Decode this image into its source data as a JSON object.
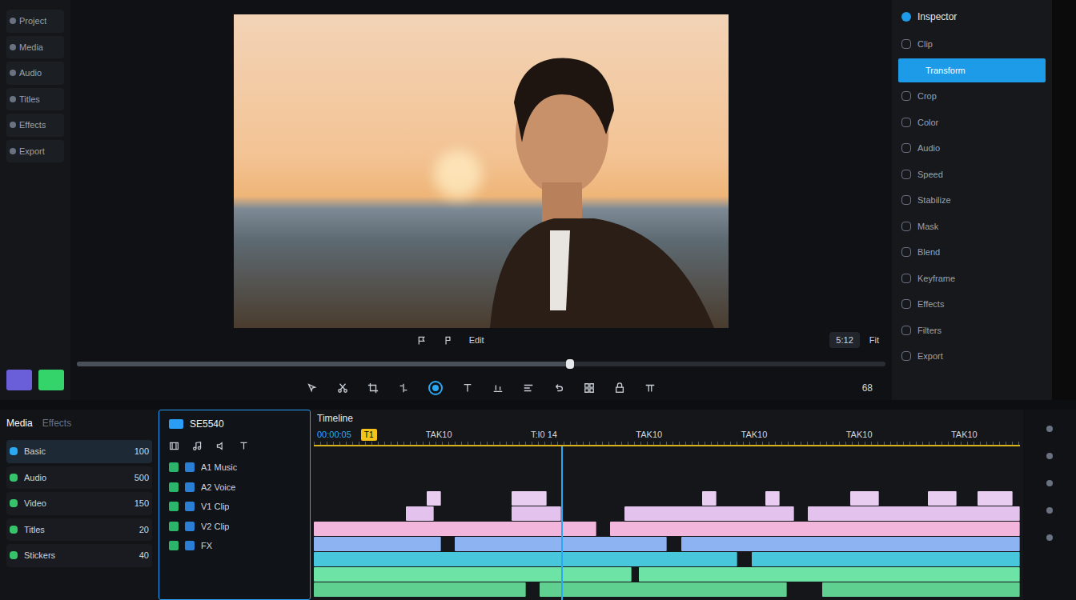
{
  "left_panel": {
    "items": [
      {
        "label": "Project"
      },
      {
        "label": "Media"
      },
      {
        "label": "Audio"
      },
      {
        "label": "Titles"
      },
      {
        "label": "Effects"
      },
      {
        "label": "Export"
      }
    ],
    "swatches": [
      {
        "color": "#6a5fd8"
      },
      {
        "color": "#35d46a"
      }
    ]
  },
  "preview": {
    "controls": [
      "Edit"
    ],
    "timecode": "5:12",
    "zoom": "Fit",
    "scrubber": {
      "level": 0.61
    },
    "zoom_value": "68"
  },
  "inspector": {
    "title": "Inspector",
    "items": [
      {
        "label": "Clip",
        "selected": false
      },
      {
        "label": "Transform",
        "selected": true
      },
      {
        "label": "Crop",
        "selected": false
      },
      {
        "label": "Color",
        "selected": false
      },
      {
        "label": "Audio",
        "selected": false
      },
      {
        "label": "Speed",
        "selected": false
      },
      {
        "label": "Stabilize",
        "selected": false
      },
      {
        "label": "Mask",
        "selected": false
      },
      {
        "label": "Blend",
        "selected": false
      },
      {
        "label": "Keyframe",
        "selected": false
      },
      {
        "label": "Effects",
        "selected": false
      },
      {
        "label": "Filters",
        "selected": false
      },
      {
        "label": "Export",
        "selected": false
      }
    ]
  },
  "media_panel": {
    "tabs": [
      {
        "label": "Media",
        "selected": true
      },
      {
        "label": "Effects",
        "selected": false
      }
    ],
    "rows": [
      {
        "label": "Basic",
        "count": "100",
        "selected": true
      },
      {
        "label": "Audio",
        "count": "500",
        "selected": false
      },
      {
        "label": "Video",
        "count": "150",
        "selected": false
      },
      {
        "label": "Titles",
        "count": "20",
        "selected": false
      },
      {
        "label": "Stickers",
        "count": "40",
        "selected": false
      }
    ]
  },
  "clip_panel": {
    "title": "SE5540",
    "rows": [
      {
        "label": "A1 Music"
      },
      {
        "label": "A2 Voice"
      },
      {
        "label": "V1 Clip"
      },
      {
        "label": "V2 Clip"
      },
      {
        "label": "FX"
      }
    ]
  },
  "timeline": {
    "title": "Timeline",
    "timecode": "00:00:05",
    "badge": "T1",
    "ticks": [
      "TAK10",
      "T:I0 14",
      "TAK10",
      "TAK10",
      "TAK10",
      "TAK10"
    ],
    "playhead": {
      "level": 0.35
    },
    "tracks": [
      {
        "color": "#e9cdf1",
        "clips": [
          [
            16,
            2
          ],
          [
            28,
            5
          ],
          [
            55,
            2
          ],
          [
            64,
            2
          ],
          [
            76,
            4
          ],
          [
            87,
            4
          ],
          [
            94,
            5
          ]
        ]
      },
      {
        "color": "#e3c3ee",
        "clips": [
          [
            13,
            4
          ],
          [
            28,
            7
          ],
          [
            44,
            24
          ],
          [
            70,
            30
          ]
        ]
      },
      {
        "color": "#f2b5dc",
        "clips": [
          [
            0,
            40
          ],
          [
            42,
            58
          ]
        ]
      },
      {
        "color": "#8eb3f2",
        "clips": [
          [
            0,
            18
          ],
          [
            20,
            30
          ],
          [
            52,
            48
          ]
        ]
      },
      {
        "color": "#48c6dc",
        "clips": [
          [
            0,
            60
          ],
          [
            62,
            38
          ]
        ]
      },
      {
        "color": "#6ee3a6",
        "clips": [
          [
            0,
            45
          ],
          [
            46,
            54
          ]
        ]
      },
      {
        "color": "#5fd08f",
        "clips": [
          [
            0,
            30
          ],
          [
            32,
            35
          ],
          [
            72,
            28
          ]
        ]
      }
    ]
  }
}
